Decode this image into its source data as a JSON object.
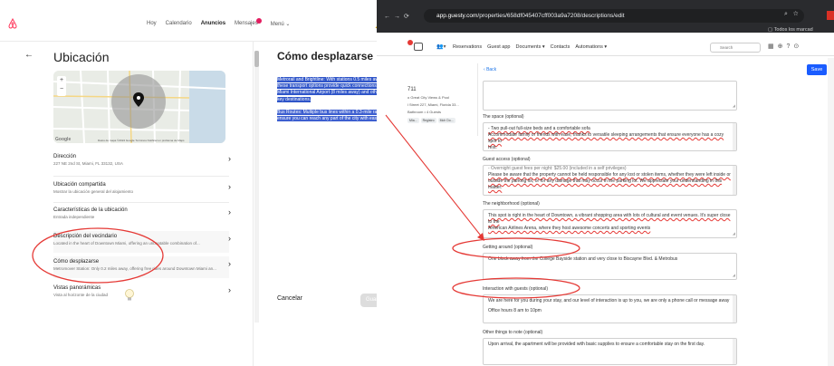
{
  "airbnb": {
    "nav": [
      "Hoy",
      "Calendario",
      "Anuncios",
      "Mensajes",
      "Menú"
    ],
    "active_nav": "Anuncios",
    "page_title": "Ubicación",
    "map_google": "Google",
    "map_credit": "Datos de mapa ©2024 Google    Términos    Notificar un problema de Maps",
    "rows": [
      {
        "title": "Dirección",
        "sub": "227 NE 2nd St, Miami, FL 33132, USA"
      },
      {
        "title": "Ubicación compartida",
        "sub": "Mostrar la ubicación general del alojamiento"
      },
      {
        "title": "Características de la ubicación",
        "sub": "Entrada independiente"
      },
      {
        "title": "Descripción del vecindario",
        "sub": "Located in the heart of Downtown Miami, offering an unbeatable combination of..."
      },
      {
        "title": "Cómo desplazarse",
        "sub": "Metromover Station: Only 0.2 miles away, offering free rides around Downtown Miami an..."
      },
      {
        "title": "Vistas panorámicas",
        "sub": "Vista al horizonte de la ciudad"
      }
    ],
    "editor_title": "Cómo desplazarse",
    "editor_para1": "Metrorail and Brightline: With stations 0.5 miles away, these transport options provide quick connections to Miami International Airport (8 miles away) and other key destinations.",
    "editor_para2": "Bus Routes: Multiple bus lines within a 0.3-mile radius ensure you can reach any part of the city with ease.",
    "cancel_label": "Cancelar",
    "save_label": "Guardar"
  },
  "browser": {
    "url_host": "app.guesty.com",
    "url_path": "/properties/658df045407cff003a9a7208/descriptions/edit",
    "bookmarks": "Todos los marcad",
    "nav_items": [
      "Reservations",
      "Guest app",
      "Documents ▾",
      "Contacts",
      "Automations ▾"
    ],
    "search_placeholder": "Search",
    "side_code": "711",
    "side_lines": [
      "o Great City Views & Pool",
      "l Street 227, Miami, Florida 33...",
      "Bathroom • 4 Guests"
    ],
    "side_chips": [
      "Mia...",
      "Registro",
      "Mch Do..."
    ],
    "back_label": "Back",
    "save_label": "Save",
    "fields": [
      {
        "label": "The space (optional)",
        "lines": [
          "- Two pull-out full-size beds and a comfortable sofa",
          "Accommodate family or friends with ease, thanks to versatile sleeping arrangements that ensure everyone has a cozy spot to",
          "rest."
        ]
      },
      {
        "label": "Guest access (optional)",
        "lines": [
          "- Overnight guest fees per night: $25.00 (included in a self privileges)",
          "Please be aware that the property cannot be held responsible for any lost or stolen items, whether they were left inside or",
          "outside the parking lot, or for any damage that may occur in the parking lot. We appreciate your understanding in this matter."
        ]
      },
      {
        "label": "The neighborhood (optional)",
        "lines": [
          "This spot is right in the heart of Downtown, a vibrant shopping area with lots of cultural and event venues. It's super close to the",
          "American Airlines Arena, where they host awesome concerts and sporting events"
        ]
      },
      {
        "label": "Getting around (optional)",
        "lines": [
          "One block away from the College Bayside station and very close to Biscayne Blvd. & Metrobus"
        ]
      },
      {
        "label": "Interaction with guests (optional)",
        "lines": [
          "We are here for you during your stay, and our level of interaction is up to you, we are only a phone call or message away",
          "",
          "Office hours 8 am to 10pm"
        ]
      },
      {
        "label": "Other things to note (optional)",
        "lines": [
          "Upon arrival, the apartment will be provided with basic supplies to ensure a comfortable stay on the first day."
        ]
      }
    ]
  },
  "colors": {
    "airbnb_brand": "#FF385C",
    "selection": "#2F55C9",
    "guesty_blue": "#1A5CFF",
    "annotation_red": "#E53935",
    "chrome_dark": "#2A2B2E"
  }
}
